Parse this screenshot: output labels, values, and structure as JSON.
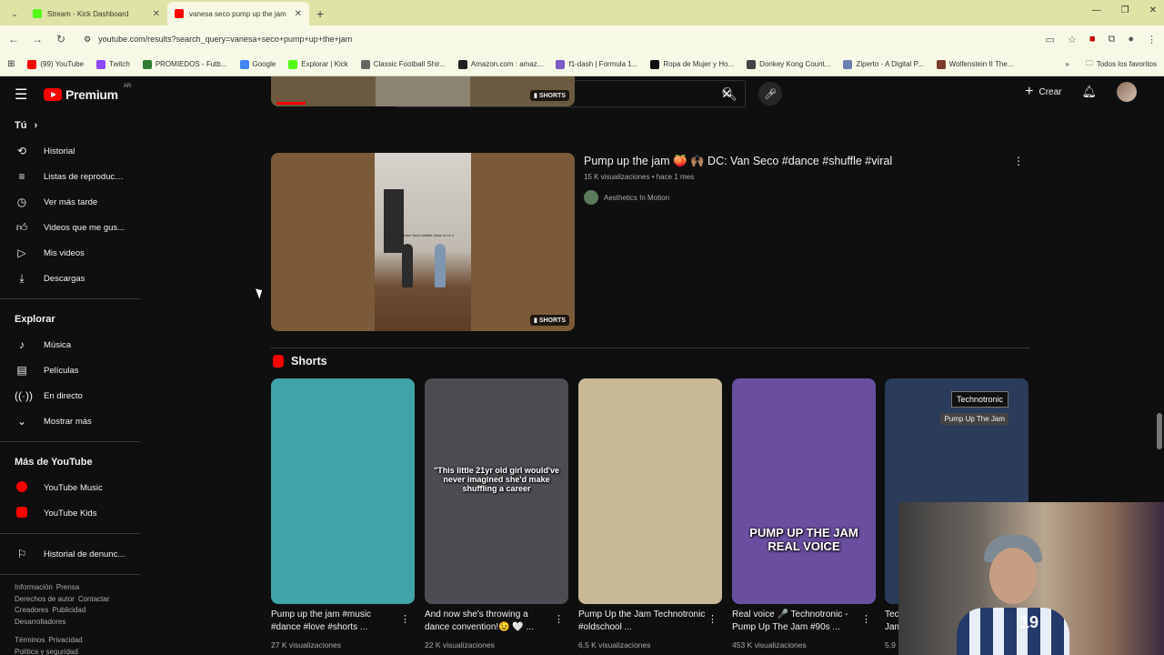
{
  "browser": {
    "tabs": [
      {
        "title": "Stream - Kick Dashboard",
        "color": "#53fc18",
        "active": false
      },
      {
        "title": "vanesa seco pump up the jam",
        "color": "#ff0000",
        "active": true
      }
    ],
    "url": "youtube.com/results?search_query=vanesa+seco+pump+up+the+jam",
    "bookmarks": [
      {
        "label": "(99) YouTube",
        "color": "#ff0000"
      },
      {
        "label": "Twitch",
        "color": "#9146ff"
      },
      {
        "label": "PROMIEDOS - Futb...",
        "color": "#2e7d32"
      },
      {
        "label": "Google",
        "color": "#4285f4"
      },
      {
        "label": "Explorar | Kick",
        "color": "#53fc18"
      },
      {
        "label": "Classic Football Shir...",
        "color": "#666666"
      },
      {
        "label": "Amazon.com : amaz...",
        "color": "#222222"
      },
      {
        "label": "f1-dash | Formula 1...",
        "color": "#7a5cc4"
      },
      {
        "label": "Ropa de Mujer y Ho...",
        "color": "#111111"
      },
      {
        "label": "Donkey Kong Count...",
        "color": "#444444"
      },
      {
        "label": "Ziperto - A Digital P...",
        "color": "#6a7fb0"
      },
      {
        "label": "Wolfenstein II The...",
        "color": "#7a3b2a"
      }
    ],
    "all_bookmarks": "Todos los favoritos"
  },
  "yt": {
    "logo_text": "Premium",
    "logo_sup": "AR",
    "search_value": "vanesa seco pump up the jam",
    "create_label": "Crear",
    "sidebar": {
      "you_label": "Tú",
      "you_items": [
        "Historial",
        "Listas de reproducc...",
        "Ver más tarde",
        "Videos que me gus...",
        "Mis videos",
        "Descargas"
      ],
      "explore_label": "Explorar",
      "explore_items": [
        "Música",
        "Películas",
        "En directo",
        "Mostrar más"
      ],
      "more_label": "Más de YouTube",
      "more_items": [
        "YouTube Music",
        "YouTube Kids"
      ],
      "report_item": "Historial de denunc...",
      "footer_lines": [
        [
          "Información",
          "Prensa"
        ],
        [
          "Derechos de autor",
          "Contactar"
        ],
        [
          "Creadores",
          "Publicidad"
        ],
        [
          "Desarrolladores"
        ],
        [],
        [
          "Términos",
          "Privacidad"
        ],
        [
          "Política y seguridad"
        ]
      ]
    },
    "shorts_badge": "SHORTS",
    "video2": {
      "title": "Pump up the jam 🍑 🙌🏽 DC: Van Seco #dance #shuffle #viral",
      "meta": "15 K visualizaciones • hace 1 mes",
      "channel": "Aesthetics In Motion",
      "thumb_caption": "POV: You take Van's shuffle class in LA !!"
    },
    "shorts_heading": "Shorts",
    "shorts": [
      {
        "title": "Pump up the jam #music #dance #love #shorts ...",
        "views": "27 K visualizaciones",
        "bg": "#3fa3a8",
        "overlay": ""
      },
      {
        "title": "And now she's throwing a dance convention!😉 🤍 ...",
        "views": "22 K visualizaciones",
        "bg": "#4c4c52",
        "overlay": "\"This little 21yr old girl would've never imagined she'd make shuffling a career"
      },
      {
        "title": "Pump Up the Jam Technotronic #oldschool ...",
        "views": "6,5 K visualizaciones",
        "bg": "#c9b896",
        "overlay": ""
      },
      {
        "title": "Real voice 🎤 Technotronic - Pump Up The Jam #90s ...",
        "views": "453 K visualizaciones",
        "bg": "#6a4fa0",
        "overlay": "PUMP UP THE JAM REAL VOICE"
      },
      {
        "title": "Tec... Jam...",
        "views": "5,9",
        "bg": "#2b3b5a",
        "overlay": "",
        "tag": "Technotronic",
        "tag2": "Pump Up The Jam"
      }
    ],
    "webcam_number": "19"
  }
}
